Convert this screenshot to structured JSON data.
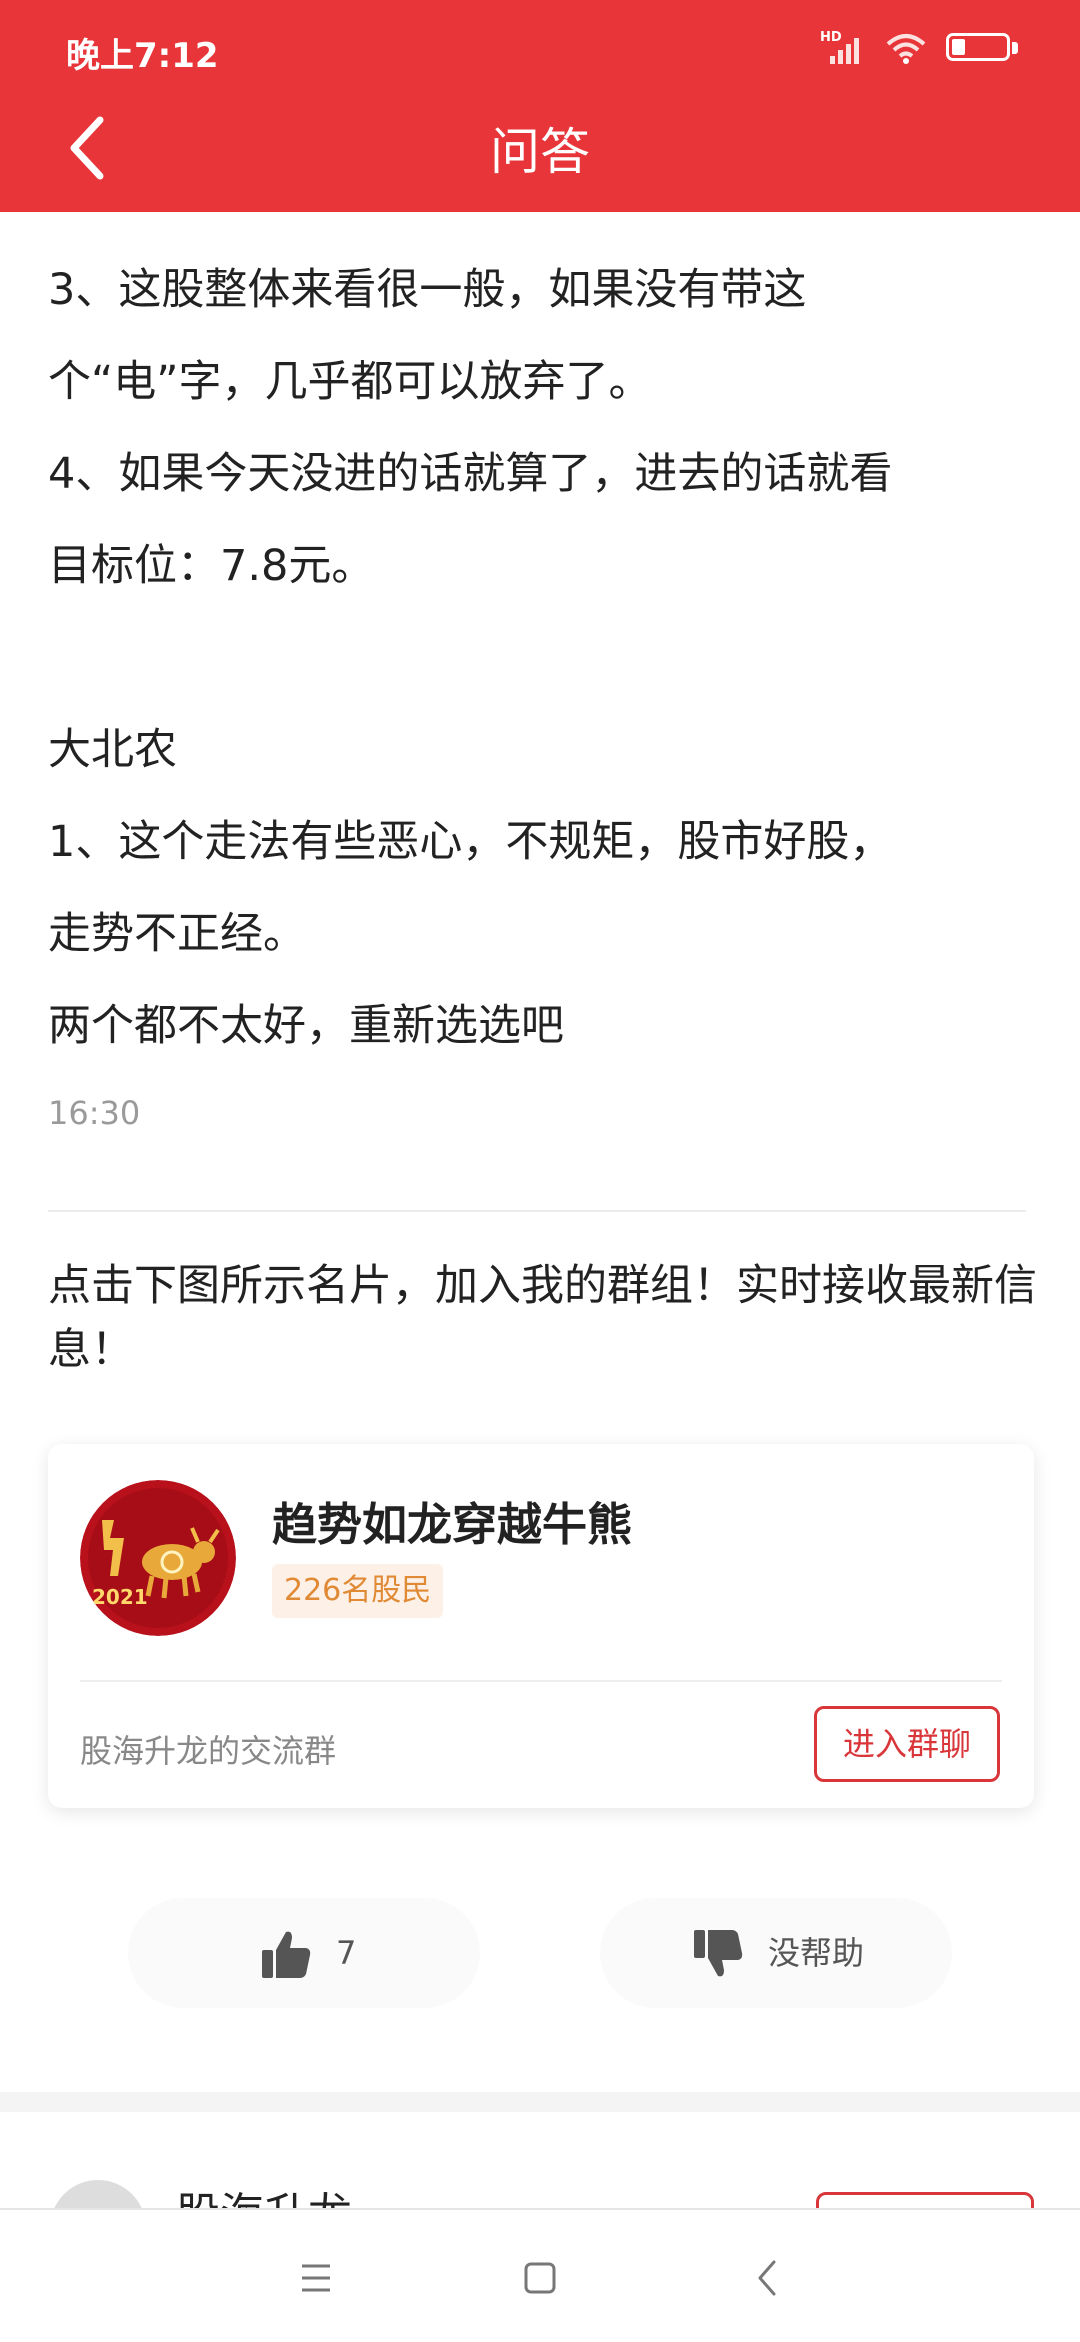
{
  "status_bar": {
    "time": "晚上7:12",
    "network_label": "HD",
    "battery_level": 0.25
  },
  "header": {
    "title": "问答"
  },
  "answer": {
    "lines": [
      "3、这股整体来看很一般，如果没有带这",
      "个“电”字，几乎都可以放弃了。",
      "4、如果今天没进的话就算了，进去的话就看",
      "目标位：7.8元。",
      "",
      "大北农",
      "1、这个走法有些恶心，不规矩，股市好股，",
      "走势不正经。",
      "两个都不太好，重新选选吧"
    ],
    "time": "16:30"
  },
  "promo_text": "点击下图所示名片，加入我的群组！实时接收最新信息！",
  "group_card": {
    "avatar_text": "2021",
    "name": "趋势如龙穿越牛熊",
    "members": "226名股民",
    "description": "股海升龙的交流群",
    "join_label": "进入群聊"
  },
  "feedback": {
    "like_count": "7",
    "dislike_label": "没帮助"
  },
  "author": {
    "name": "股海升龙"
  },
  "colors": {
    "brand_red": "#e83539",
    "badge_orange": "#e08a35"
  }
}
